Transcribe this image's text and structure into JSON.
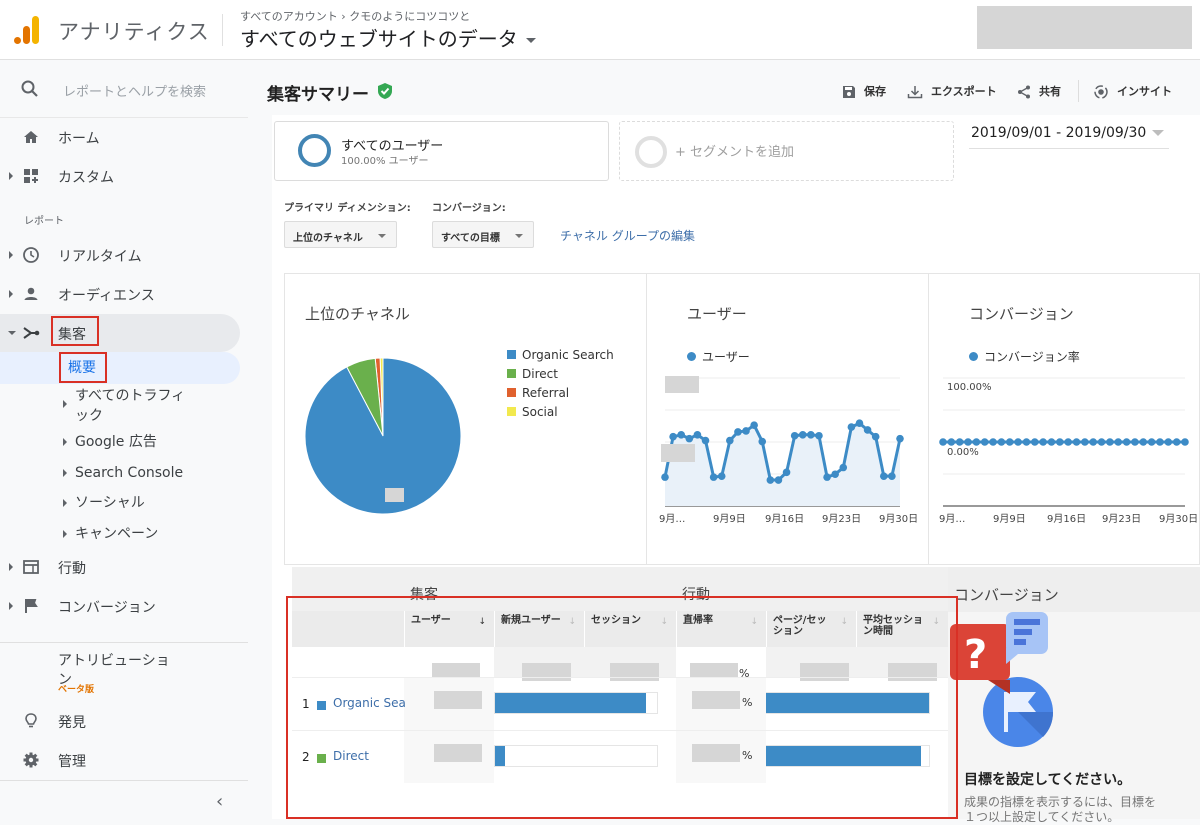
{
  "header": {
    "app_name": "アナリティクス",
    "breadcrumb": [
      "すべてのアカウント",
      "クモのようにコツコツと"
    ],
    "breadcrumb_sep": "›",
    "property": "すべてのウェブサイトのデータ"
  },
  "sidebar": {
    "search_placeholder": "レポートとヘルプを検索",
    "home": "ホーム",
    "custom": "カスタム",
    "reports_label": "レポート",
    "realtime": "リアルタイム",
    "audience": "オーディエンス",
    "acquisition": "集客",
    "acquisition_children": [
      {
        "label": "概要",
        "selected": true
      },
      {
        "label": "すべてのトラフィック"
      },
      {
        "label": "Google 広告"
      },
      {
        "label": "Search Console"
      },
      {
        "label": "ソーシャル"
      },
      {
        "label": "キャンペーン"
      }
    ],
    "behavior": "行動",
    "conversions": "コンバージョン",
    "attribution": "アトリビューション",
    "attribution_badge": "ベータ版",
    "discover": "発見",
    "admin": "管理",
    "collapse_icon": "‹"
  },
  "main": {
    "title": "集客サマリー",
    "toolbar": {
      "save": "保存",
      "export": "エクスポート",
      "share": "共有",
      "insights": "インサイト"
    },
    "segment": {
      "title": "すべてのユーザー",
      "subtitle": "100.00% ユーザー",
      "add": "+ セグメントを追加"
    },
    "date_range": "2019/09/01 - 2019/09/30",
    "primary_dimension_label": "プライマリ ディメンション:",
    "primary_dimension_value": "上位のチャネル",
    "conversion_label": "コンバージョン:",
    "conversion_value": "すべての目標",
    "edit_channel_link": "チャネル グループの編集"
  },
  "chart_data": [
    {
      "type": "pie",
      "title": "上位のチャネル",
      "categories": [
        "Organic Search",
        "Direct",
        "Referral",
        "Social"
      ],
      "values": [
        92.3,
        6.1,
        1.0,
        0.6
      ],
      "colors": [
        "#3d8bc6",
        "#6ab04c",
        "#e0612e",
        "#f2e94e"
      ],
      "legend": "right"
    },
    {
      "type": "area",
      "title": "ユーザー",
      "legend_label": "ユーザー",
      "color": "#3d8bc6",
      "x_ticks": [
        "9月…",
        "9月9日",
        "9月16日",
        "9月23日",
        "9月30日"
      ],
      "y_relative": [
        0.3,
        0.72,
        0.74,
        0.7,
        0.74,
        0.68,
        0.3,
        0.31,
        0.68,
        0.77,
        0.78,
        0.84,
        0.67,
        0.27,
        0.27,
        0.35,
        0.73,
        0.74,
        0.74,
        0.73,
        0.3,
        0.33,
        0.4,
        0.82,
        0.86,
        0.79,
        0.72,
        0.31,
        0.31,
        0.7
      ],
      "ylim_relative": [
        0,
        1.33
      ],
      "note": "Axis tick values redacted in source"
    },
    {
      "type": "line",
      "title": "コンバージョン",
      "legend_label": "コンバージョン率",
      "color": "#3d8bc6",
      "y_ticks": [
        "100.00%",
        "0.00%"
      ],
      "x_ticks": [
        "9月…",
        "9月9日",
        "9月16日",
        "9月23日",
        "9月30日"
      ],
      "values": [
        0,
        0,
        0,
        0,
        0,
        0,
        0,
        0,
        0,
        0,
        0,
        0,
        0,
        0,
        0,
        0,
        0,
        0,
        0,
        0,
        0,
        0,
        0,
        0,
        0,
        0,
        0,
        0,
        0,
        0
      ]
    }
  ],
  "table": {
    "group_headers": [
      "集客",
      "行動"
    ],
    "columns": [
      {
        "label": "ユーザー",
        "sorted": true
      },
      {
        "label": "新規ユーザー",
        "sorted": false
      },
      {
        "label": "セッション",
        "sorted": false
      },
      {
        "label": "直帰率",
        "sorted": false
      },
      {
        "label": "ページ/セッション",
        "sorted": false
      },
      {
        "label": "平均セッション時間",
        "sorted": false
      }
    ],
    "sort_icon": "↓",
    "pct_sign": "%",
    "rows": [
      {
        "rank": "1",
        "channel": "Organic Search",
        "color": "#3d8bc6",
        "new_users_share": 0.93,
        "pages_per_session_share": 1.0
      },
      {
        "rank": "2",
        "channel": "Direct",
        "color": "#6ab04c",
        "new_users_share": 0.06,
        "pages_per_session_share": 0.95
      }
    ]
  },
  "conversion_panel": {
    "header": "コンバージョン",
    "title": "目標を設定してください。",
    "description": "成果の指標を表示するには、目標を１つ以上設定してください。"
  }
}
